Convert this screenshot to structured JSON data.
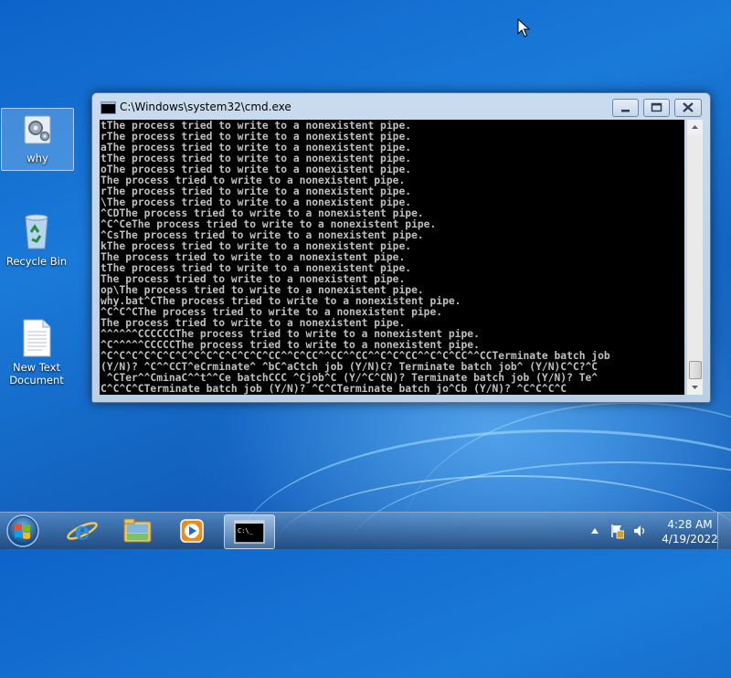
{
  "desktop": {
    "icons": [
      {
        "name": "why"
      },
      {
        "name": "Recycle Bin"
      },
      {
        "name": "New Text Document"
      }
    ]
  },
  "window": {
    "title": "C:\\Windows\\system32\\cmd.exe",
    "console_lines": [
      "tThe process tried to write to a nonexistent pipe.",
      "rThe process tried to write to a nonexistent pipe.",
      "aThe process tried to write to a nonexistent pipe.",
      "tThe process tried to write to a nonexistent pipe.",
      "oThe process tried to write to a nonexistent pipe.",
      "The process tried to write to a nonexistent pipe.",
      "rThe process tried to write to a nonexistent pipe.",
      "\\The process tried to write to a nonexistent pipe.",
      "^CDThe process tried to write to a nonexistent pipe.",
      "^C^CeThe process tried to write to a nonexistent pipe.",
      "^CsThe process tried to write to a nonexistent pipe.",
      "kThe process tried to write to a nonexistent pipe.",
      "The process tried to write to a nonexistent pipe.",
      "tThe process tried to write to a nonexistent pipe.",
      "The process tried to write to a nonexistent pipe.",
      "op\\The process tried to write to a nonexistent pipe.",
      "why.bat^CThe process tried to write to a nonexistent pipe.",
      "^C^C^CThe process tried to write to a nonexistent pipe.",
      "The process tried to write to a nonexistent pipe.",
      "^^^^^^CCCCCCThe process tried to write to a nonexistent pipe.",
      "^C^^^^^CCCCCThe process tried to write to a nonexistent pipe.",
      "^C^C^C^C^C^C^C^C^C^C^C^C^C^CC^^C^CC^^CC^^CC^^C^C^CC^^C^C^CC^^CCTerminate batch job",
      "(Y/N)? ^C^^CCT^eCrminate^ ^bC^aCtch job (Y/N)C? Terminate batch job^ (Y/N)C^C?^C",
      " ^CTer^^CminaC^^t^^Ce batchCCC ^Cjob^C (Y/^C^CN)? Terminate batch job (Y/N)? Te^",
      "C^C^C^CTerminate batch job (Y/N)? ^C^CTerminate batch jo^Cb (Y/N)? ^C^C^C^C"
    ]
  },
  "taskbar": {
    "pinned": [
      "start-button",
      "internet-explorer",
      "windows-explorer",
      "media-player",
      "cmd"
    ],
    "clock_time": "4:28 AM",
    "clock_date": "4/19/2022"
  }
}
